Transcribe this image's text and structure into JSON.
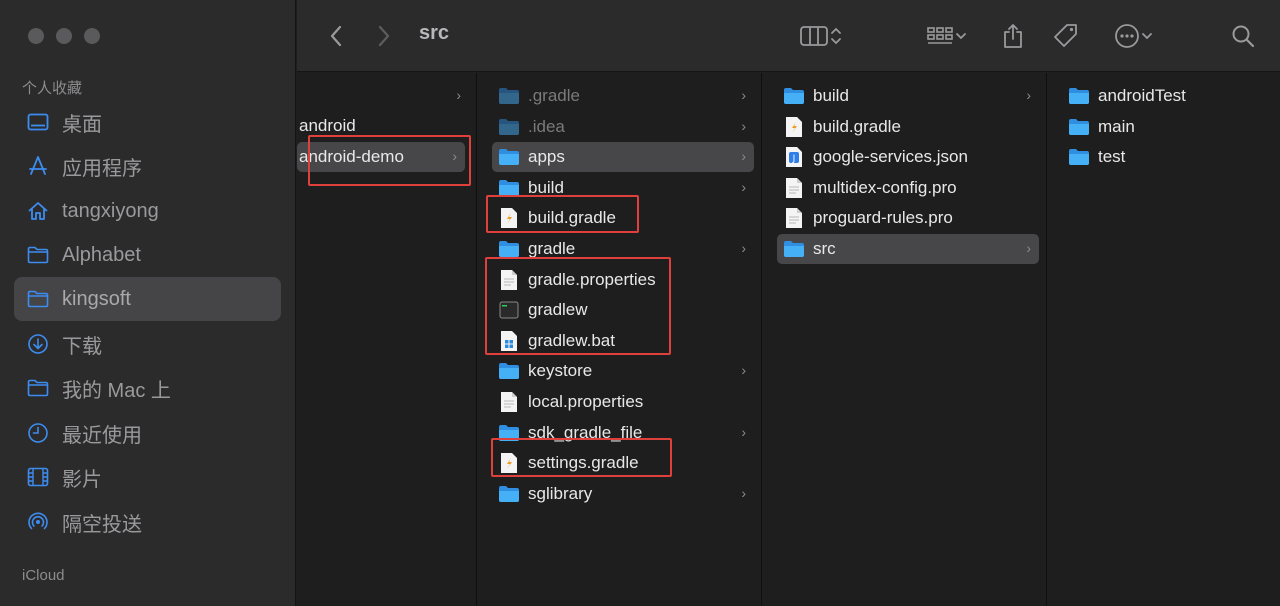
{
  "toolbar": {
    "title": "src",
    "icons": [
      "back-icon",
      "forward-icon",
      "column-view-icon",
      "group-icon",
      "share-icon",
      "tag-icon",
      "more-icon",
      "search-icon"
    ]
  },
  "sidebar": {
    "favorites_header": "个人收藏",
    "items": [
      {
        "label": "桌面",
        "icon": "desktop-icon"
      },
      {
        "label": "应用程序",
        "icon": "applications-icon"
      },
      {
        "label": "tangxiyong",
        "icon": "home-icon"
      },
      {
        "label": "Alphabet",
        "icon": "folder-icon"
      },
      {
        "label": "kingsoft",
        "icon": "folder-icon",
        "selected": true
      },
      {
        "label": "下载",
        "icon": "download-icon"
      },
      {
        "label": "我的 Mac 上",
        "icon": "folder-icon"
      },
      {
        "label": "最近使用",
        "icon": "clock-icon"
      },
      {
        "label": "影片",
        "icon": "film-icon"
      },
      {
        "label": "隔空投送",
        "icon": "airdrop-icon"
      }
    ],
    "icloud_header": "iCloud"
  },
  "columns": {
    "col1": [
      {
        "name": "",
        "chevron": true
      },
      {
        "name": "android",
        "chevron": false
      },
      {
        "name": "android-demo",
        "chevron": true,
        "selected": true
      }
    ],
    "col2": [
      {
        "name": ".gradle",
        "type": "folder",
        "chevron": true,
        "dim": true
      },
      {
        "name": ".idea",
        "type": "folder",
        "chevron": true,
        "dim": true
      },
      {
        "name": "apps",
        "type": "folder",
        "chevron": true,
        "selected": true
      },
      {
        "name": "build",
        "type": "folder",
        "chevron": true
      },
      {
        "name": "build.gradle",
        "type": "gradle"
      },
      {
        "name": "gradle",
        "type": "folder",
        "chevron": true
      },
      {
        "name": "gradle.properties",
        "type": "doc"
      },
      {
        "name": "gradlew",
        "type": "exec"
      },
      {
        "name": "gradlew.bat",
        "type": "bat"
      },
      {
        "name": "keystore",
        "type": "folder",
        "chevron": true
      },
      {
        "name": "local.properties",
        "type": "doc"
      },
      {
        "name": "sdk_gradle_file",
        "type": "folder",
        "chevron": true
      },
      {
        "name": "settings.gradle",
        "type": "gradle"
      },
      {
        "name": "sglibrary",
        "type": "folder",
        "chevron": true
      }
    ],
    "col3": [
      {
        "name": "build",
        "type": "folder",
        "chevron": true
      },
      {
        "name": "build.gradle",
        "type": "gradle"
      },
      {
        "name": "google-services.json",
        "type": "json"
      },
      {
        "name": "multidex-config.pro",
        "type": "doc"
      },
      {
        "name": "proguard-rules.pro",
        "type": "doc"
      },
      {
        "name": "src",
        "type": "folder",
        "chevron": true,
        "selected": true
      }
    ],
    "col4": [
      {
        "name": "androidTest",
        "type": "folder"
      },
      {
        "name": "main",
        "type": "folder"
      },
      {
        "name": "test",
        "type": "folder"
      }
    ]
  },
  "colors": {
    "accent_folder": "#3ba3f4",
    "highlight_box": "#e0403b",
    "gradle_icon": "#f29a1f"
  }
}
